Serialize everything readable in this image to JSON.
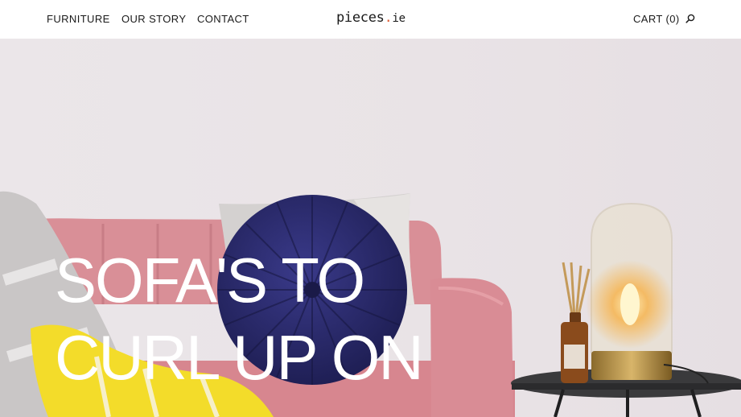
{
  "header": {
    "nav": [
      "FURNITURE",
      "OUR STORY",
      "CONTACT"
    ],
    "logo": {
      "name": "pieces",
      "dot": ".",
      "tld": "ie"
    },
    "cart_label": "CART (0)"
  },
  "icons": {
    "search": "search-icon"
  },
  "hero": {
    "title_line1": "SOFA'S TO",
    "title_line2": "CURL UP ON"
  },
  "colors": {
    "accent": "#e0623a",
    "wall": "#e9e3e6",
    "sofa": "#d98f97",
    "cushion": "#2a2a6b",
    "throw_yellow": "#f3dc2a"
  }
}
